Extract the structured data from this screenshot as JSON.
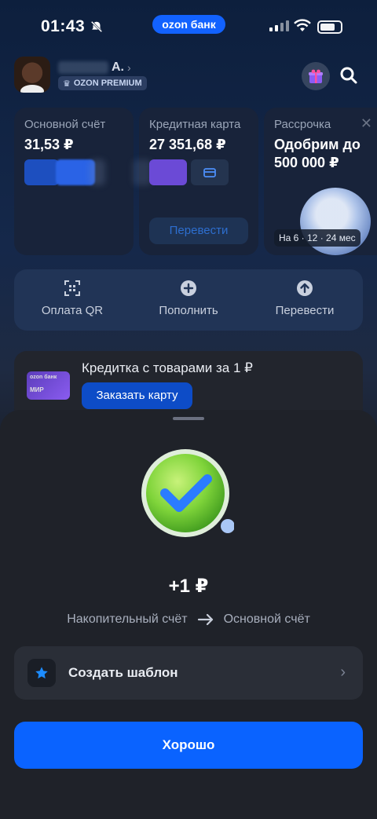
{
  "status_bar": {
    "time": "01:43",
    "carrier": "ozon банк"
  },
  "profile": {
    "name_suffix": "А.",
    "premium_label": "OZON PREMIUM"
  },
  "accounts": [
    {
      "title": "Основной счёт",
      "amount": "31,53 ₽"
    },
    {
      "title": "Кредитная карта",
      "amount": "27 351,68 ₽",
      "button": "Перевести"
    },
    {
      "title": "Рассрочка",
      "amount": "Одобрим до 500 000 ₽",
      "term": "На 6 · 12 · 24 мес"
    }
  ],
  "actions": [
    {
      "label": "Оплата QR",
      "icon": "qr-icon"
    },
    {
      "label": "Пополнить",
      "icon": "plus-circle-icon"
    },
    {
      "label": "Перевести",
      "icon": "arrow-up-circle-icon"
    }
  ],
  "promo": {
    "card_brand": "ozon банк",
    "card_network": "МИР",
    "title": "Кредитка с товарами за 1 ₽",
    "button": "Заказать карту"
  },
  "sheet": {
    "amount": "+1 ₽",
    "from": "Накопительный счёт",
    "to": "Основной счёт",
    "template_label": "Создать шаблон",
    "ok_label": "Хорошо"
  },
  "colors": {
    "accent": "#0a63ff",
    "success": "#7fd43a"
  }
}
